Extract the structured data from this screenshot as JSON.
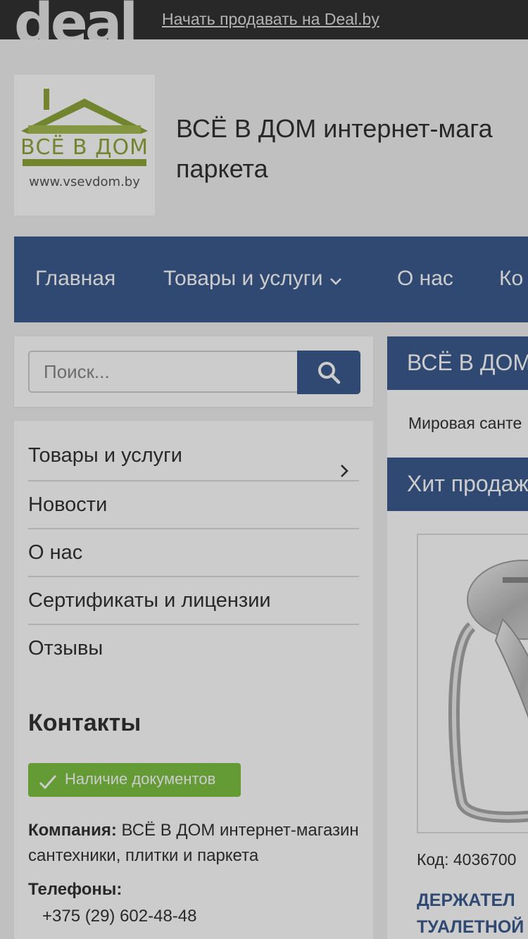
{
  "topbar": {
    "brand": "deal",
    "sell_link": "Начать продавать на Deal.by"
  },
  "header": {
    "logo": {
      "name": "ВСЁ В ДОМ",
      "url": "www.vsevdom.by"
    },
    "title_line1": "ВСЁ В ДОМ интернет-мага",
    "title_line2": "паркета"
  },
  "nav": {
    "items": [
      {
        "label": "Главная"
      },
      {
        "label": "Товары и услуги"
      },
      {
        "label": "О нас"
      },
      {
        "label": "Ко"
      }
    ]
  },
  "search": {
    "placeholder": "Поиск..."
  },
  "sidebar": {
    "menu": [
      {
        "label": "Товары и услуги"
      },
      {
        "label": "Новости"
      },
      {
        "label": "О нас"
      },
      {
        "label": "Сертификаты и лицензии"
      },
      {
        "label": "Отзывы"
      }
    ],
    "contacts_title": "Контакты",
    "docs_badge": "Наличие документов",
    "company_label": "Компания:",
    "company_value": "ВСЁ В ДОМ интернет-магазин сантехники, плитки и паркета",
    "phones_label": "Телефоны:",
    "phone": "+375 (29) 602-48-48"
  },
  "main": {
    "panel1_title": "ВСЁ В ДОМ",
    "panel1_text": "Мировая санте",
    "panel2_title": "Хит продаж",
    "product": {
      "code": "Код: 4036700",
      "name_line1": "ДЕРЖАТЕЛ",
      "name_line2": "ТУАЛЕТНОЙ"
    }
  },
  "colors": {
    "nav_blue": "#3d5c8f",
    "topbar": "#333333",
    "badge_green": "#7dc242",
    "logo_green": "#8ea63a"
  }
}
